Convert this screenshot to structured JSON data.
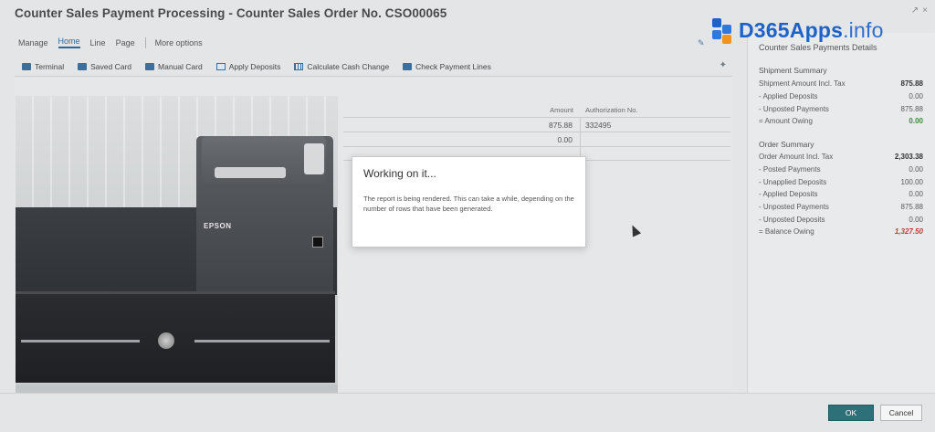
{
  "window": {
    "title": "Counter Sales Payment Processing - Counter Sales Order No. CSO00065"
  },
  "menu": {
    "items": [
      {
        "label": "Manage",
        "active": false
      },
      {
        "label": "Home",
        "active": true
      },
      {
        "label": "Line",
        "active": false
      },
      {
        "label": "Page",
        "active": false
      }
    ],
    "more_label": "More options"
  },
  "toolbar": {
    "actions": [
      {
        "label": "Terminal",
        "icon": "terminal-icon"
      },
      {
        "label": "Saved Card",
        "icon": "card-icon"
      },
      {
        "label": "Manual Card",
        "icon": "card-icon"
      },
      {
        "label": "Apply Deposits",
        "icon": "document-icon"
      },
      {
        "label": "Calculate Cash Change",
        "icon": "calculator-icon"
      },
      {
        "label": "Check Payment Lines",
        "icon": "checklist-icon"
      }
    ]
  },
  "grid": {
    "headers": {
      "amount": "Amount",
      "auth": "Authorization No."
    },
    "rows": [
      {
        "amount": "875.88",
        "auth": "332495"
      },
      {
        "amount": "0.00",
        "auth": ""
      }
    ]
  },
  "modal": {
    "title": "Working on it...",
    "message": "The report is being rendered. This can take a while, depending on the number of rows that have been generated."
  },
  "photo": {
    "printer_brand": "EPSON"
  },
  "logo": {
    "brand": "D365Apps",
    "suffix": ".info"
  },
  "details": {
    "title": "Counter Sales Payments Details",
    "shipment": {
      "heading": "Shipment Summary",
      "rows": [
        {
          "label": "Shipment Amount Incl. Tax",
          "value": "875.88",
          "style": "bold"
        },
        {
          "label": "- Applied Deposits",
          "value": "0.00",
          "style": ""
        },
        {
          "label": "- Unposted Payments",
          "value": "875.88",
          "style": ""
        },
        {
          "label": "= Amount Owing",
          "value": "0.00",
          "style": "green"
        }
      ]
    },
    "order": {
      "heading": "Order Summary",
      "rows": [
        {
          "label": "Order Amount Incl. Tax",
          "value": "2,303.38",
          "style": "bold"
        },
        {
          "label": "- Posted Payments",
          "value": "0.00",
          "style": ""
        },
        {
          "label": "- Unapplied Deposits",
          "value": "100.00",
          "style": ""
        },
        {
          "label": "- Applied Deposits",
          "value": "0.00",
          "style": ""
        },
        {
          "label": "- Unposted Payments",
          "value": "875.88",
          "style": ""
        },
        {
          "label": "- Unposted Deposits",
          "value": "0.00",
          "style": ""
        },
        {
          "label": "= Balance Owing",
          "value": "1,327.50",
          "style": "red"
        }
      ]
    }
  },
  "footer": {
    "ok_label": "OK",
    "cancel_label": "Cancel"
  },
  "colors": {
    "accent": "#2d7079",
    "link": "#2a6a9a",
    "owing_zero": "#3c8a3c",
    "balance_owing": "#c23a3a",
    "logo_blue": "#1e62c8"
  }
}
